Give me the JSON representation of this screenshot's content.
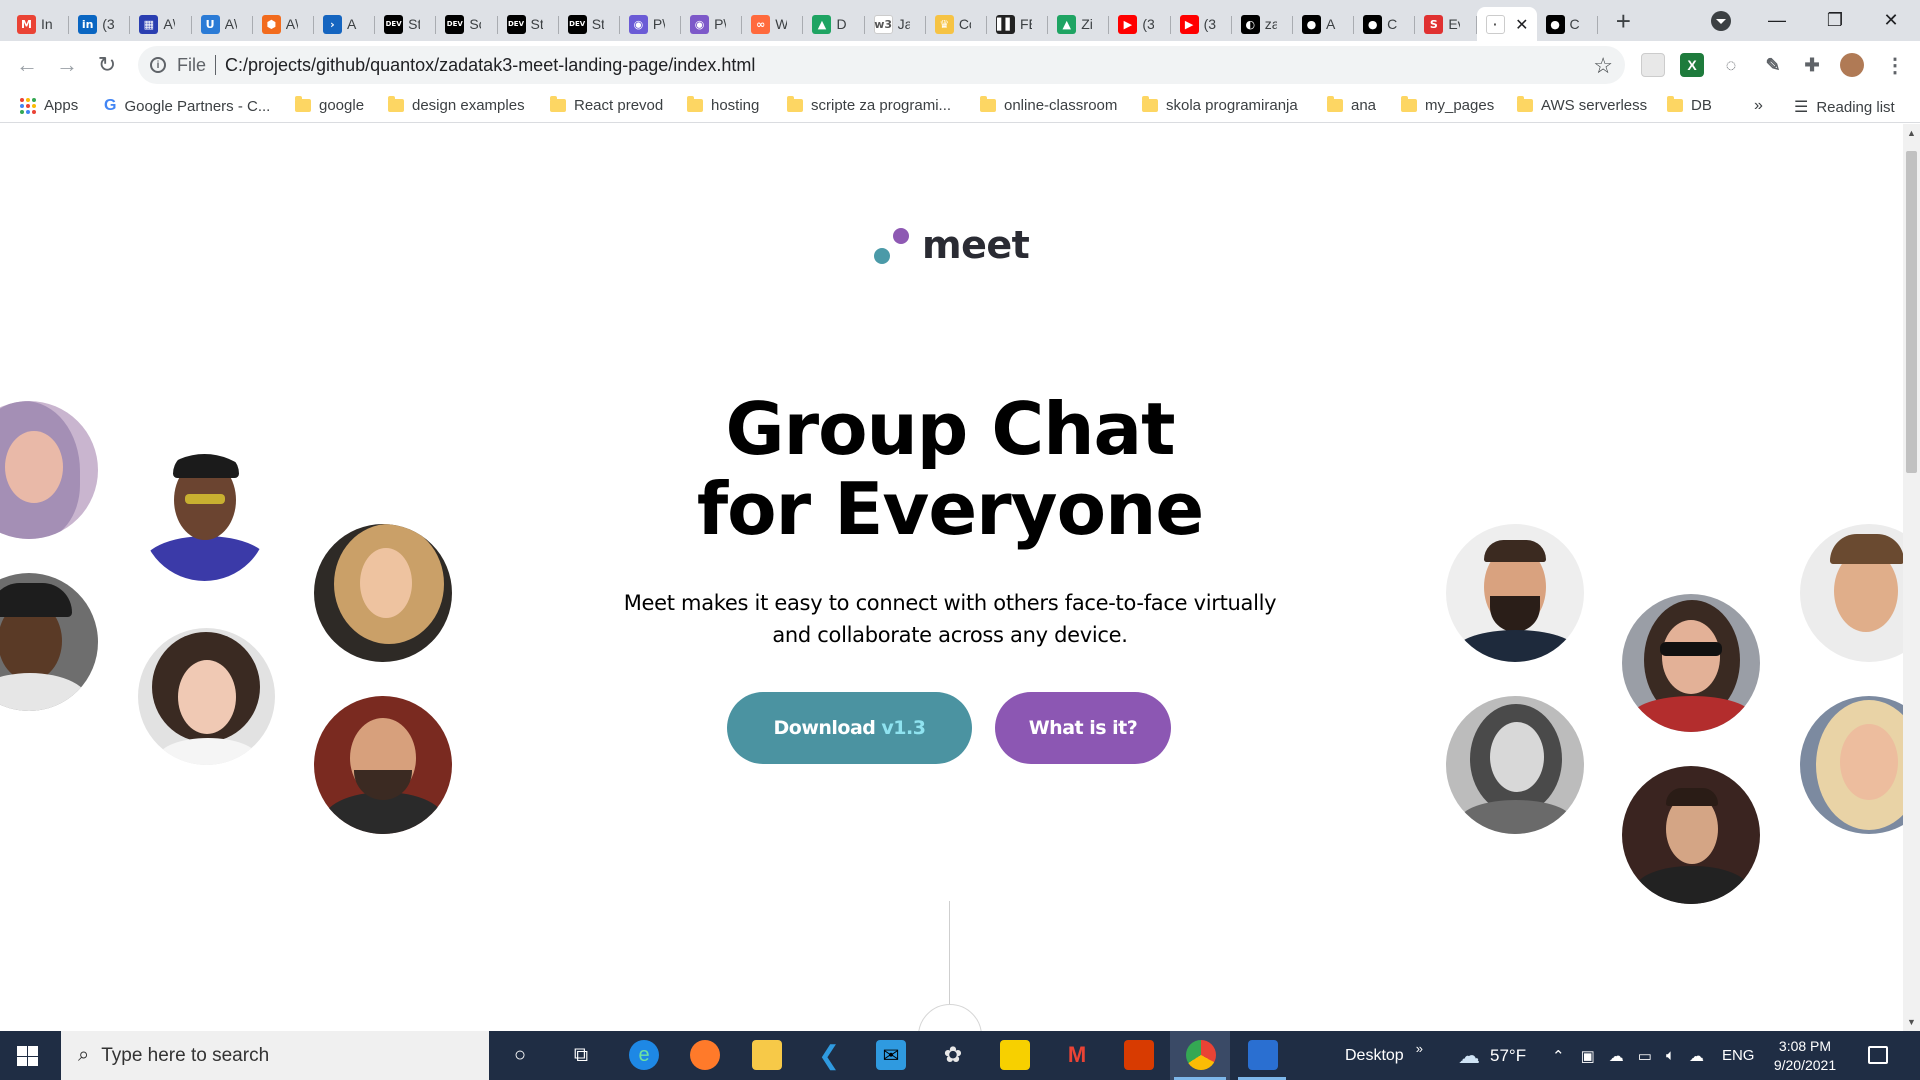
{
  "tabs": [
    {
      "title": "In",
      "icon": "gmail-icon",
      "color": "#ea4335",
      "glyph": "M"
    },
    {
      "title": "(3",
      "icon": "linkedin-icon",
      "color": "#0a66c2",
      "glyph": "in"
    },
    {
      "title": "A\\",
      "icon": "calendar-icon",
      "color": "#2a3eb1",
      "glyph": "▦"
    },
    {
      "title": "A\\",
      "icon": "u-icon",
      "color": "#2b7bd6",
      "glyph": "U"
    },
    {
      "title": "A\\",
      "icon": "hexagon-icon",
      "color": "#f26b1d",
      "glyph": "⬢"
    },
    {
      "title": "A",
      "icon": "azure-icon",
      "color": "#1565c0",
      "glyph": "›"
    },
    {
      "title": "St",
      "icon": "dev-icon",
      "color": "#000000",
      "glyph": "DEV"
    },
    {
      "title": "Sc",
      "icon": "dev-icon",
      "color": "#000000",
      "glyph": "DEV"
    },
    {
      "title": "St",
      "icon": "dev-icon",
      "color": "#000000",
      "glyph": "DEV"
    },
    {
      "title": "St",
      "icon": "dev-icon",
      "color": "#000000",
      "glyph": "DEV"
    },
    {
      "title": "P\\",
      "icon": "robot-icon",
      "color": "#6b5bd6",
      "glyph": "◉"
    },
    {
      "title": "P\\",
      "icon": "robot-icon",
      "color": "#7d59c9",
      "glyph": "◉"
    },
    {
      "title": "W",
      "icon": "link-icon",
      "color": "#ff6a3d",
      "glyph": "∞"
    },
    {
      "title": "D",
      "icon": "drive-icon",
      "color": "#1fa463",
      "glyph": "▲"
    },
    {
      "title": "Ja",
      "icon": "w3schools-icon",
      "color": "#ffffff",
      "glyph": "w3"
    },
    {
      "title": "Cc",
      "icon": "crown-icon",
      "color": "#f6c344",
      "glyph": "♛"
    },
    {
      "title": "FE",
      "icon": "frontend-icon",
      "color": "#222222",
      "glyph": "▌▌"
    },
    {
      "title": "Zi",
      "icon": "drive-icon",
      "color": "#1fa463",
      "glyph": "▲"
    },
    {
      "title": "(3",
      "icon": "youtube-icon",
      "color": "#ff0000",
      "glyph": "▶"
    },
    {
      "title": "(3",
      "icon": "youtube-icon",
      "color": "#ff0000",
      "glyph": "▶"
    },
    {
      "title": "za",
      "icon": "zeplin-icon",
      "color": "#000000",
      "glyph": "◐"
    },
    {
      "title": "A",
      "icon": "github-icon",
      "color": "#000000",
      "glyph": "●"
    },
    {
      "title": "C",
      "icon": "github-icon",
      "color": "#000000",
      "glyph": "●"
    },
    {
      "title": "Ev",
      "icon": "s-icon",
      "color": "#e03131",
      "glyph": "S"
    },
    {
      "title": "",
      "icon": "meet-favicon-icon",
      "color": "#ffffff",
      "glyph": "·",
      "active": true
    },
    {
      "title": "C",
      "icon": "github-icon",
      "color": "#000000",
      "glyph": "●"
    }
  ],
  "toolbar": {
    "scheme": "File",
    "url": "C:/projects/github/quantox/zadatak3-meet-landing-page/index.html"
  },
  "bookmarks": {
    "apps": "Apps",
    "google_partners": "Google Partners - C...",
    "folders": [
      "google",
      "design examples",
      "React prevod",
      "hosting",
      "scripte za programi...",
      "online-classroom",
      "skola programiranja",
      "ana",
      "my_pages",
      "AWS serverless",
      "DB"
    ],
    "more": "»",
    "reading_list": "Reading list"
  },
  "page": {
    "logo_text": "meet",
    "headline_line1": "Group Chat",
    "headline_line2": "for Everyone",
    "subtitle_line1": "Meet makes it easy to connect with others face-to-face virtually",
    "subtitle_line2": "and collaborate across any device.",
    "download_label": "Download",
    "download_version": "v1.3",
    "what_label": "What is it?",
    "colors": {
      "teal": "#4b93a1",
      "purple": "#8c57b3",
      "version": "#8fe3f0"
    }
  },
  "taskbar": {
    "search_placeholder": "Type here to search",
    "desktop_label": "Desktop",
    "more": "»",
    "temperature": "57°F",
    "language": "ENG",
    "time": "3:08 PM",
    "date": "9/20/2021"
  }
}
